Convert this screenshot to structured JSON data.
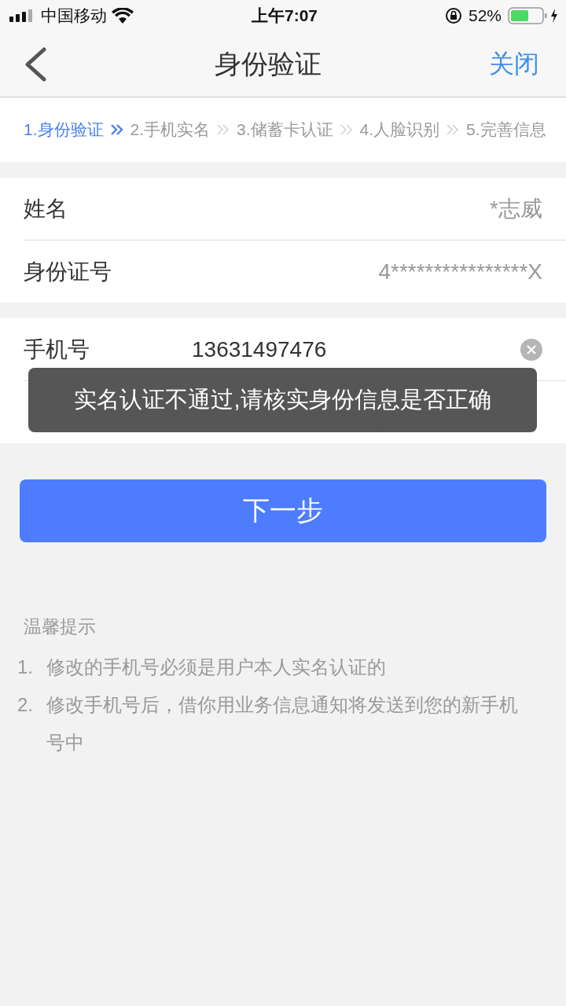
{
  "status_bar": {
    "carrier": "中国移动",
    "time": "上午7:07",
    "battery_percent": "52%"
  },
  "nav": {
    "title": "身份验证",
    "close": "关闭"
  },
  "steps": [
    {
      "label": "1.身份验证",
      "selected": true
    },
    {
      "label": "2.手机实名",
      "selected": false
    },
    {
      "label": "3.储蓄卡认证",
      "selected": false
    },
    {
      "label": "4.人脸识别",
      "selected": false
    },
    {
      "label": "5.完善信息",
      "selected": false
    }
  ],
  "identity_fields": [
    {
      "label": "姓名",
      "value": "*志威"
    },
    {
      "label": "身份证号",
      "value": "4****************X"
    }
  ],
  "phone_fields": [
    {
      "kind": "phone",
      "label": "手机号",
      "value": "13631497476"
    },
    {
      "kind": "code"
    }
  ],
  "next_button": "下一步",
  "toast": "实名认证不通过,请核实身份信息是否正确",
  "tips": {
    "title": "温馨提示",
    "items": [
      {
        "number": "1.",
        "text": "修改的手机号必须是用户本人实名认证的"
      },
      {
        "number": "2.",
        "text": "修改手机号后，借你用业务信息通知将发送到您的新手机号中"
      }
    ]
  }
}
